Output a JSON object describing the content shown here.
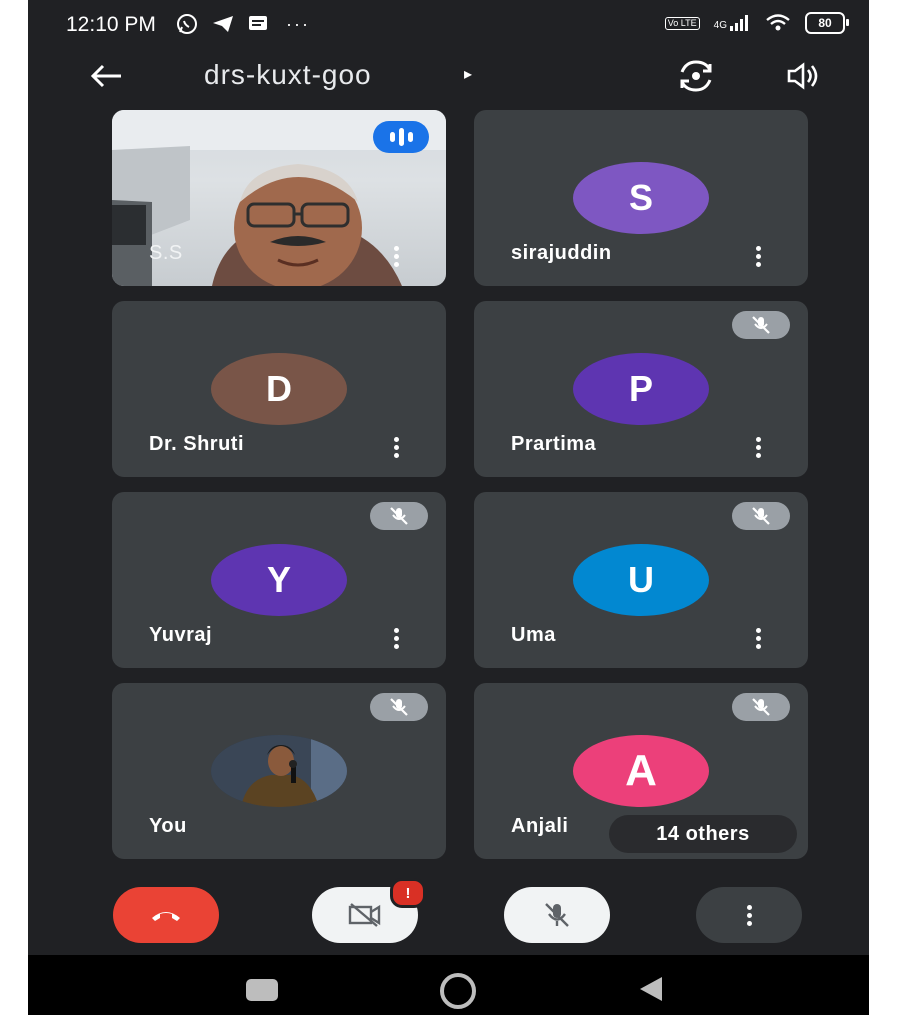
{
  "status_bar": {
    "time": "12:10 PM",
    "dots": "···",
    "network": "4G",
    "volte": "Vo LTE",
    "battery": "80"
  },
  "header": {
    "meeting_code": "drs-kuxt-goo",
    "caret": "▸"
  },
  "participants": [
    {
      "name": "S.S",
      "type": "video",
      "speaking": true,
      "muted": false
    },
    {
      "name": "sirajuddin",
      "initial": "S",
      "avatar_color": "#7e57c2",
      "muted": false
    },
    {
      "name": "Dr. Shruti",
      "initial": "D",
      "avatar_color": "#795548",
      "muted": false
    },
    {
      "name": "Prartima",
      "initial": "P",
      "avatar_color": "#5e35b1",
      "muted": true
    },
    {
      "name": "Yuvraj",
      "initial": "Y",
      "avatar_color": "#5e35b1",
      "muted": true
    },
    {
      "name": "Uma",
      "initial": "U",
      "avatar_color": "#0288d1",
      "muted": true
    },
    {
      "name": "You",
      "type": "photo",
      "muted": true
    },
    {
      "name": "Anjali",
      "initial": "A",
      "avatar_color": "#ec407a",
      "muted": true
    }
  ],
  "others_count_label": "14 others",
  "controls": {
    "camera_alert": "!"
  },
  "colors": {
    "background": "#202124",
    "tile": "#3c4043",
    "end_call": "#ea4335",
    "speaking": "#1a73e8"
  }
}
